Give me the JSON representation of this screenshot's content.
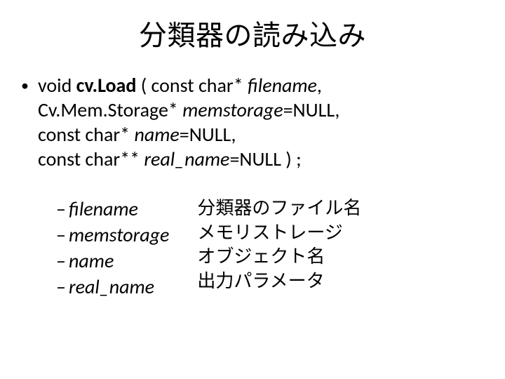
{
  "title": "分類器の読み込み",
  "signature": {
    "line1_prefix": "void ",
    "line1_func": "cv.Load",
    "line1_after": " ( const char* ",
    "line1_arg": "filename",
    "line1_tail": ",",
    "line2_prefix": "Cv.Mem.Storage* ",
    "line2_arg": "memstorage",
    "line2_tail": "=NULL,",
    "line3_prefix": "const char* ",
    "line3_arg": "name",
    "line3_tail": "=NULL,",
    "line4_prefix": "const char** ",
    "line4_arg": "real_name",
    "line4_tail": "=NULL ) ;"
  },
  "bullet_glyph": "•",
  "dash_glyph": "–",
  "params": {
    "names": [
      "filename",
      "memstorage",
      "name",
      "real_name"
    ],
    "descs": [
      "分類器のファイル名",
      "メモリストレージ",
      "オブジェクト名",
      "出力パラメータ"
    ]
  }
}
